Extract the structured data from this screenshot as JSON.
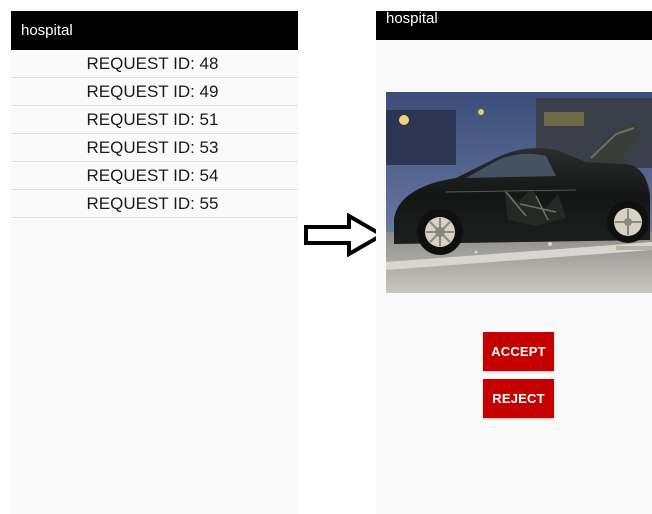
{
  "left_screen": {
    "app_title": "hospital",
    "requests": [
      {
        "label": "REQUEST ID: 48"
      },
      {
        "label": "REQUEST ID: 49"
      },
      {
        "label": "REQUEST ID: 51"
      },
      {
        "label": "REQUEST ID: 53"
      },
      {
        "label": "REQUEST ID: 54"
      },
      {
        "label": "REQUEST ID: 55"
      }
    ]
  },
  "transition_icon": "right-arrow-icon",
  "right_screen": {
    "app_title": "hospital",
    "photo_icon": "accident-photo",
    "accept_label": "ACCEPT",
    "reject_label": "REJECT"
  },
  "colors": {
    "toolbar": "#000000",
    "button": "#c40000",
    "background": "#fafafa"
  }
}
